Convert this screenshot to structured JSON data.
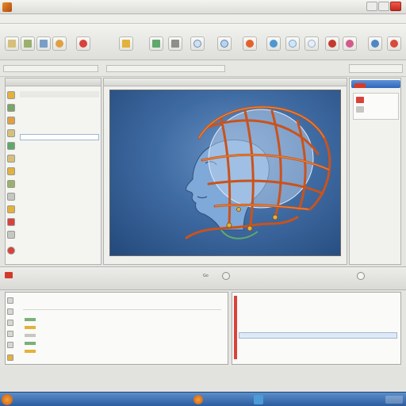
{
  "window": {
    "title": ""
  },
  "menu": {
    "items": []
  },
  "toolbar": {
    "sub_labels": []
  },
  "left_panel": {
    "title": "",
    "rows": []
  },
  "canvas": {
    "title": "",
    "image_description": ""
  },
  "right_panel": {
    "rows": []
  },
  "bottom_bar": {
    "labels": [
      "Go"
    ]
  },
  "log_panel": {
    "rows": []
  },
  "properties": {
    "rows": []
  },
  "taskbar": {
    "items": []
  },
  "colors": {
    "accent": "#2f67b8",
    "close": "#d83a2a",
    "canvas_bg": "#3f6ba3",
    "wire": "#c9531d"
  }
}
